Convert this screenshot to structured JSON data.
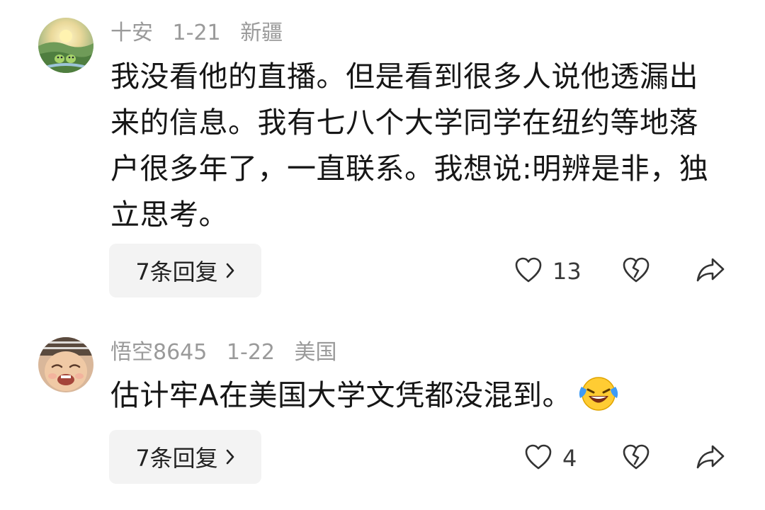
{
  "comments": [
    {
      "username": "十安",
      "date": "1-21",
      "location": "新疆",
      "text": "我没看他的直播。但是看到很多人说他透漏出来的信息。我有七八个大学同学在纽约等地落户很多年了，一直联系。我想说:明辨是非，独立思考。",
      "reply_label": "7条回复",
      "like_count": "13",
      "avatar": "nature-scene-avatar"
    },
    {
      "username": "悟空8645",
      "date": "1-22",
      "location": "美国",
      "text": "估计牢A在美国大学文凭都没混到。",
      "emoji": "laughing-crying-emoji",
      "reply_label": "7条回复",
      "like_count": "4",
      "avatar": "baby-face-avatar"
    }
  ],
  "icons": {
    "like": "heart-outline-icon",
    "dislike": "broken-heart-icon",
    "share": "share-arrow-icon",
    "chevron": "chevron-right-icon"
  },
  "colors": {
    "meta": "#9a9a9a",
    "text": "#161616",
    "reply_bg": "#f3f3f3",
    "icon": "#333333"
  }
}
